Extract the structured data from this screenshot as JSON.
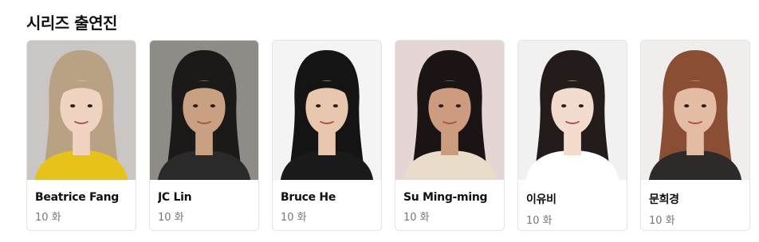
{
  "section": {
    "title": "시리즈 출연진"
  },
  "cast": [
    {
      "name": "Beatrice Fang",
      "episodes": "10 화",
      "bg": "#c9c6c4",
      "hair": "#b9a184",
      "skin": "#f1d3c2",
      "shirt": "#e7c31a"
    },
    {
      "name": "JC Lin",
      "episodes": "10 화",
      "bg": "#8f8c88",
      "hair": "#1c1a18",
      "skin": "#caa083",
      "shirt": "#2a2a2a"
    },
    {
      "name": "Bruce He",
      "episodes": "10 화",
      "bg": "#f4f4f4",
      "hair": "#141414",
      "skin": "#e8c7ae",
      "shirt": "#1a1a1a"
    },
    {
      "name": "Su Ming-ming",
      "episodes": "10 화",
      "bg": "#e6d5d5",
      "hair": "#1a1414",
      "skin": "#cc9b80",
      "shirt": "#e9dcc9"
    },
    {
      "name": "이유비",
      "episodes": "10 화",
      "bg": "#f1f1f1",
      "hair": "#241c1a",
      "skin": "#f3dccd",
      "shirt": "#ffffff"
    },
    {
      "name": "문희경",
      "episodes": "10 화",
      "bg": "#f0eeec",
      "hair": "#8a4e34",
      "skin": "#e4bca4",
      "shirt": "#2d2a2a"
    }
  ]
}
